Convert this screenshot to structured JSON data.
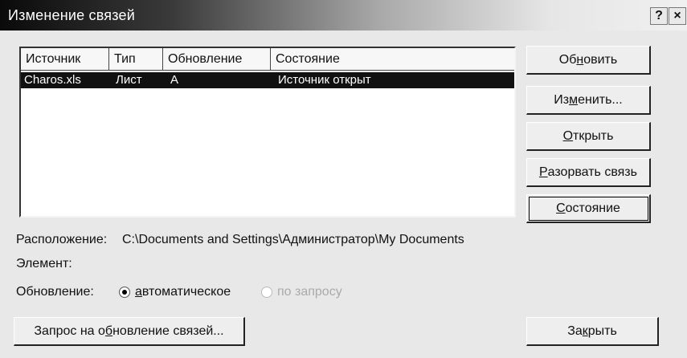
{
  "window": {
    "title": "Изменение связей",
    "help_label": "?",
    "close_label": "×"
  },
  "links_table": {
    "columns": [
      "Источник",
      "Тип",
      "Обновление",
      "Состояние"
    ],
    "rows": [
      {
        "source": "Charos.xls",
        "type": "Лист",
        "update": "A",
        "status": "Источник открыт",
        "selected": true
      }
    ]
  },
  "buttons": {
    "update": {
      "before": "Об",
      "accel": "н",
      "after": "овить"
    },
    "change": {
      "before": "Из",
      "accel": "м",
      "after": "енить..."
    },
    "open": {
      "before": "",
      "accel": "О",
      "after": "ткрыть"
    },
    "break": {
      "before": "",
      "accel": "Р",
      "after": "азорвать связь"
    },
    "status": {
      "before": "",
      "accel": "С",
      "after": "остояние"
    },
    "startup": {
      "before": "Запрос на о",
      "accel": "б",
      "after": "новление связей..."
    },
    "close": {
      "before": "За",
      "accel": "к",
      "after": "рыть"
    }
  },
  "details": {
    "location_label": "Расположение:",
    "location_value": "C:\\Documents and Settings\\Администратор\\My Documents",
    "item_label": "Элемент:",
    "update_label": "Обновление:",
    "auto_option": {
      "before": "",
      "accel": "а",
      "after": "втоматическое",
      "checked": true
    },
    "manual_option": {
      "label": "по запросу",
      "checked": false,
      "enabled": false
    }
  }
}
